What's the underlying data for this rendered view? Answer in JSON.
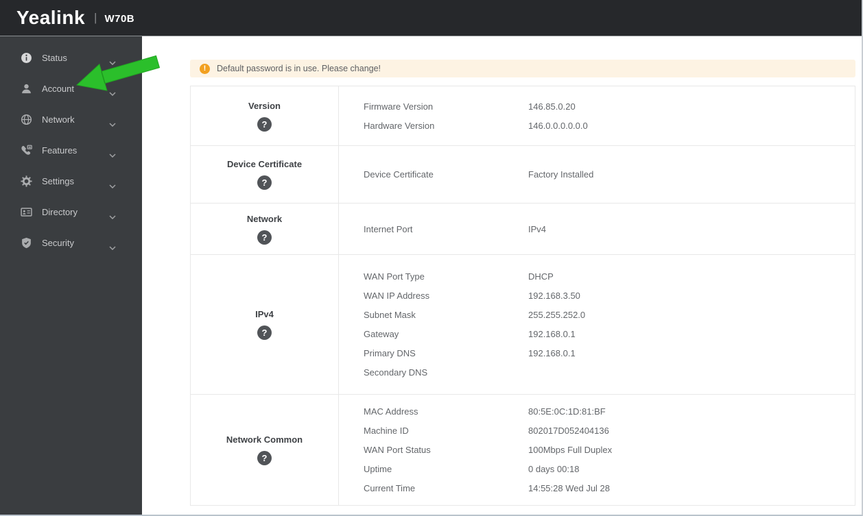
{
  "header": {
    "brand": "Yealink",
    "divider": "|",
    "model": "W70B"
  },
  "sidebar": {
    "items": [
      {
        "label": "Status",
        "icon": "info-icon"
      },
      {
        "label": "Account",
        "icon": "user-icon"
      },
      {
        "label": "Network",
        "icon": "globe-icon"
      },
      {
        "label": "Features",
        "icon": "phone-icon"
      },
      {
        "label": "Settings",
        "icon": "gear-icon"
      },
      {
        "label": "Directory",
        "icon": "contact-card-icon"
      },
      {
        "label": "Security",
        "icon": "shield-icon"
      }
    ]
  },
  "banner": {
    "icon": "warning-icon",
    "symbol": "!",
    "text": "Default password is in use. Please change!"
  },
  "annotation": {
    "type": "green-arrow",
    "points_at": "Account",
    "color": "#2bbf2b"
  },
  "status_table": {
    "help_symbol": "?",
    "sections": [
      {
        "title": "Version",
        "rows": [
          {
            "label": "Firmware Version",
            "value": "146.85.0.20"
          },
          {
            "label": "Hardware Version",
            "value": "146.0.0.0.0.0.0"
          }
        ]
      },
      {
        "title": "Device Certificate",
        "rows": [
          {
            "label": "Device Certificate",
            "value": "Factory Installed"
          }
        ]
      },
      {
        "title": "Network",
        "rows": [
          {
            "label": "Internet Port",
            "value": "IPv4"
          }
        ]
      },
      {
        "title": "IPv4",
        "rows": [
          {
            "label": "WAN Port Type",
            "value": "DHCP"
          },
          {
            "label": "WAN IP Address",
            "value": "192.168.3.50"
          },
          {
            "label": "Subnet Mask",
            "value": "255.255.252.0"
          },
          {
            "label": "Gateway",
            "value": "192.168.0.1"
          },
          {
            "label": "Primary DNS",
            "value": "192.168.0.1"
          },
          {
            "label": "Secondary DNS",
            "value": ""
          }
        ]
      },
      {
        "title": "Network Common",
        "rows": [
          {
            "label": "MAC Address",
            "value": "80:5E:0C:1D:81:BF"
          },
          {
            "label": "Machine ID",
            "value": "802017D052404136"
          },
          {
            "label": "WAN Port Status",
            "value": "100Mbps Full Duplex"
          },
          {
            "label": "Uptime",
            "value": "0 days 00:18"
          },
          {
            "label": "Current Time",
            "value": "14:55:28 Wed Jul 28"
          }
        ]
      }
    ]
  },
  "colors": {
    "topbar_bg": "#26282b",
    "sidebar_bg": "#3a3d40",
    "banner_bg": "#fdf3e3",
    "warning_orange": "#f2a01f",
    "arrow_green": "#2bbf2b",
    "table_border": "#e8e8e8"
  }
}
